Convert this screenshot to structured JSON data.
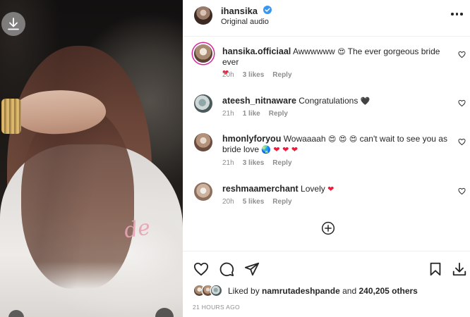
{
  "post": {
    "username": "ihansika",
    "subtitle": "Original audio",
    "verified_icon": "verified-badge-icon",
    "more_icon": "more-options-icon"
  },
  "comments": [
    {
      "username": "hansika.officiaal",
      "text_before": "Awwwwww",
      "emoji1": "😍",
      "text_after": "The ever gorgeous bride ever",
      "emoji2": "❤",
      "time": "20h",
      "likes": "3 likes",
      "reply": "Reply"
    },
    {
      "username": "ateesh_nitnaware",
      "text": "Congratulations",
      "emoji": "🖤",
      "time": "21h",
      "likes": "1 like",
      "reply": "Reply"
    },
    {
      "username": "hmonlyforyou",
      "text_before": "Wowaaaah",
      "emoji1": "😍 😍 😍",
      "text_mid": "can't wait to see you as bride love",
      "emoji2": "🌏",
      "emoji3": "❤ ❤ ❤",
      "time": "21h",
      "likes": "3 likes",
      "reply": "Reply"
    },
    {
      "username": "reshmaamerchant",
      "text": "Lovely",
      "emoji": "❤",
      "time": "20h",
      "likes": "5 likes",
      "reply": "Reply"
    }
  ],
  "load_more_icon": "plus-circle-icon",
  "actions": {
    "like_icon": "heart-icon",
    "comment_icon": "comment-icon",
    "share_icon": "paper-plane-icon",
    "save_icon": "bookmark-icon",
    "download_icon": "download-icon"
  },
  "likes": {
    "prefix": "Liked by",
    "user": "namrutadeshpande",
    "conj": "and",
    "count": "240,205 others"
  },
  "timestamp": "21 HOURS AGO",
  "media": {
    "embroidery_text": "de",
    "download_icon": "download-icon"
  }
}
